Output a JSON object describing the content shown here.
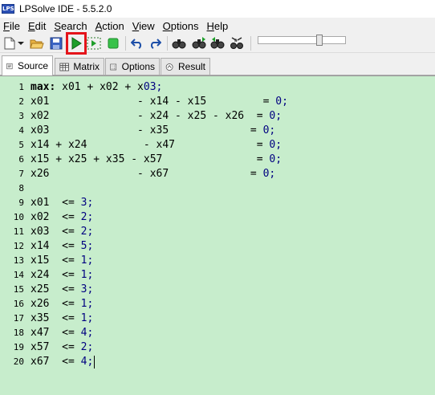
{
  "window": {
    "title": "LPSolve IDE - 5.5.2.0",
    "logo_text": "LPS"
  },
  "menu": [
    {
      "label": "File",
      "accel": "F",
      "rest": "ile"
    },
    {
      "label": "Edit",
      "accel": "E",
      "rest": "dit"
    },
    {
      "label": "Search",
      "accel": "S",
      "rest": "earch"
    },
    {
      "label": "Action",
      "accel": "A",
      "rest": "ction"
    },
    {
      "label": "View",
      "accel": "V",
      "rest": "iew"
    },
    {
      "label": "Options",
      "accel": "O",
      "rest": "ptions"
    },
    {
      "label": "Help",
      "accel": "H",
      "rest": "elp"
    }
  ],
  "toolbar": {
    "buttons": [
      "new-file",
      "new-dropdown",
      "open",
      "save",
      "run",
      "step",
      "stop",
      "undo",
      "redo",
      "find",
      "find-next",
      "find-previous",
      "replace"
    ],
    "highlighted": "run",
    "slider_level": 0.72
  },
  "tabs": [
    {
      "label": "Source",
      "icon": "source-icon",
      "active": true
    },
    {
      "label": "Matrix",
      "icon": "matrix-icon",
      "active": false
    },
    {
      "label": "Options",
      "icon": "options-icon",
      "active": false
    },
    {
      "label": "Result",
      "icon": "result-icon",
      "active": false
    }
  ],
  "editor": {
    "background": "#c7edcc",
    "lines": [
      {
        "n": "1",
        "kw": "max:",
        "text": " x01 + x02 + x03;"
      },
      {
        "n": "2",
        "kw": "",
        "text": "x01              - x14 - x15         = 0;"
      },
      {
        "n": "3",
        "kw": "",
        "text": "x02              - x24 - x25 - x26  = 0;"
      },
      {
        "n": "4",
        "kw": "",
        "text": "x03              - x35             = 0;"
      },
      {
        "n": "5",
        "kw": "",
        "text": "x14 + x24         - x47             = 0;"
      },
      {
        "n": "6",
        "kw": "",
        "text": "x15 + x25 + x35 - x57               = 0;"
      },
      {
        "n": "7",
        "kw": "",
        "text": "x26              - x67             = 0;"
      },
      {
        "n": "8",
        "kw": "",
        "text": ""
      },
      {
        "n": "9",
        "kw": "",
        "text": "x01  <= 3;"
      },
      {
        "n": "10",
        "kw": "",
        "text": "x02  <= 2;"
      },
      {
        "n": "11",
        "kw": "",
        "text": "x03  <= 2;"
      },
      {
        "n": "12",
        "kw": "",
        "text": "x14  <= 5;"
      },
      {
        "n": "13",
        "kw": "",
        "text": "x15  <= 1;"
      },
      {
        "n": "14",
        "kw": "",
        "text": "x24  <= 1;"
      },
      {
        "n": "15",
        "kw": "",
        "text": "x25  <= 3;"
      },
      {
        "n": "16",
        "kw": "",
        "text": "x26  <= 1;"
      },
      {
        "n": "17",
        "kw": "",
        "text": "x35  <= 1;"
      },
      {
        "n": "18",
        "kw": "",
        "text": "x47  <= 4;"
      },
      {
        "n": "19",
        "kw": "",
        "text": "x57  <= 2;"
      },
      {
        "n": "20",
        "kw": "",
        "text": "x67  <= 4;"
      }
    ]
  }
}
